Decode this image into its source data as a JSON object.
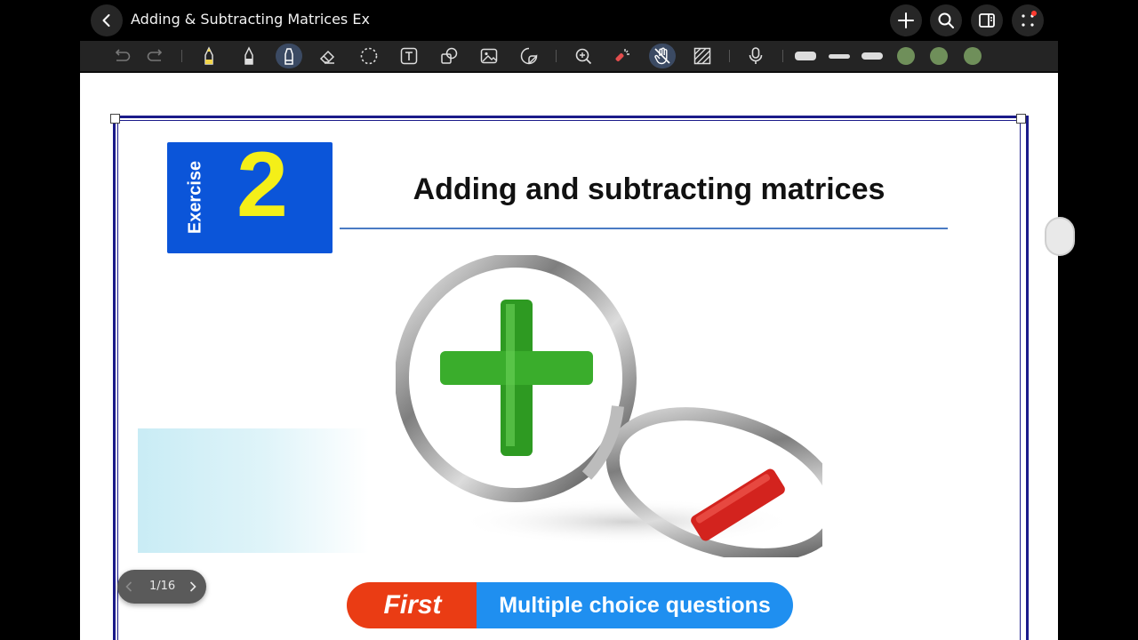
{
  "header": {
    "title": "Adding & Subtracting Matrices Ex",
    "back_icon": "chevron-left-icon",
    "actions": [
      "add-icon",
      "search-icon",
      "sidebar-toggle-icon",
      "more-apps-icon"
    ]
  },
  "toolbar": {
    "tools": [
      "undo-icon",
      "redo-icon",
      "pencil-icon",
      "pen-icon",
      "highlighter-icon",
      "eraser-icon",
      "lasso-icon",
      "text-box-icon",
      "shapes-icon",
      "image-icon",
      "sticker-icon",
      "zoom-icon",
      "laser-pointer-icon",
      "hand-draw-icon",
      "pattern-icon",
      "microphone-icon"
    ],
    "active_tools": [
      "highlighter-icon",
      "hand-draw-icon"
    ],
    "stroke_widths": 3,
    "colors": [
      "#6f8f5a",
      "#6f8f5a",
      "#6f8f5a"
    ]
  },
  "page": {
    "exercise_word": "Exercise",
    "exercise_number": "2",
    "heading": "Adding and subtracting matrices",
    "banner_first": "First",
    "banner_second": "Multiple choice questions"
  },
  "pager": {
    "label": "1/16"
  },
  "colors": {
    "exercise_box": "#0b55d9",
    "exercise_number": "#f4ef18",
    "banner_first": "#ea3c14",
    "banner_second": "#1f8ff0",
    "frame": "#1b1b8a"
  }
}
